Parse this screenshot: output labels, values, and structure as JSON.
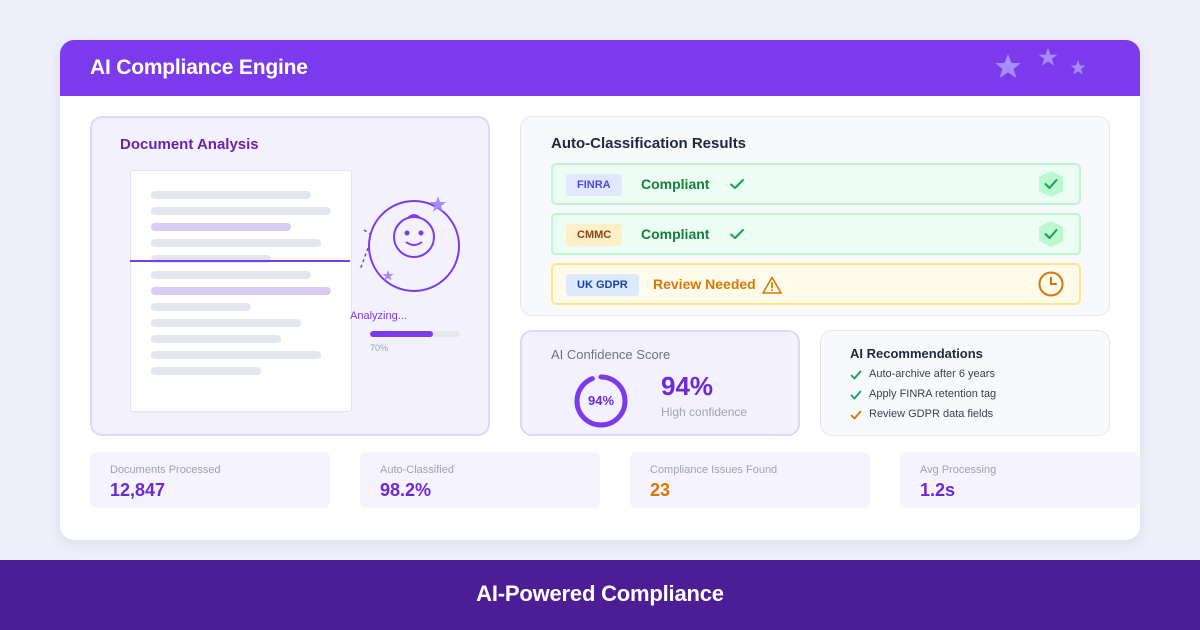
{
  "header": {
    "title": "AI Compliance Engine",
    "decor_icon": "stars-icon"
  },
  "document_analysis": {
    "title": "Document Analysis",
    "status": "Analyzing...",
    "progress": 0.7,
    "progress_label": "70%",
    "icon": "robot-face-icon"
  },
  "classification": {
    "title": "Auto-Classification Results",
    "results": [
      {
        "regulation": "FINRA",
        "status": "Compliant",
        "state": "ok",
        "icon": "shield-check-icon"
      },
      {
        "regulation": "CMMC",
        "status": "Compliant",
        "state": "ok",
        "icon": "shield-check-icon"
      },
      {
        "regulation": "UK GDPR",
        "status": "Review Needed",
        "state": "warn",
        "icon": "clock-icon"
      }
    ]
  },
  "confidence": {
    "title": "AI Confidence Score",
    "ring_label": "94%",
    "value": "94%",
    "score": 0.94,
    "description": "High confidence"
  },
  "recommendations": {
    "title": "AI Recommendations",
    "items": [
      {
        "text": "Auto-archive after 6 years",
        "state": "ok"
      },
      {
        "text": "Apply FINRA retention tag",
        "state": "ok"
      },
      {
        "text": "Review GDPR data fields",
        "state": "warn"
      }
    ]
  },
  "stats": [
    {
      "label": "Documents Processed",
      "value": "12,847"
    },
    {
      "label": "Auto-Classified",
      "value": "98.2%"
    },
    {
      "label": "Compliance Issues Found",
      "value": "23"
    },
    {
      "label": "Avg Processing",
      "value": "1.2s"
    }
  ],
  "footer": {
    "text": "AI-Powered Compliance"
  },
  "colors": {
    "brand": "#7c3aed",
    "footer": "#4c1d95",
    "success": "#15803d",
    "warning": "#d97706",
    "background": "#edf0f8"
  }
}
